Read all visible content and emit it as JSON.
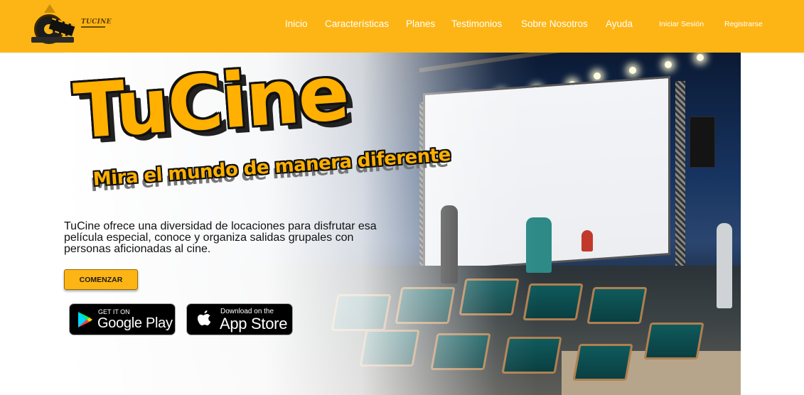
{
  "navbar": {
    "brand": "TUCINE",
    "links": [
      "Inicio",
      "Características",
      "Planes",
      "Testimonios",
      "Sobre Nosotros",
      "Ayuda"
    ],
    "login": "Iniciar Sesión",
    "register": "Registrarse",
    "bg_color": "#fdb515"
  },
  "hero": {
    "title": "TuCine",
    "tagline": "Mira el mundo de manera diferente",
    "description": "TuCine ofrece una diversidad de locaciones para disfrutar esa película especial, conoce y organiza salidas grupales con personas aficionadas al cine.",
    "cta": "COMENZAR",
    "google_play": {
      "small": "GET IT ON",
      "big": "Google Play",
      "icon": "google-play-icon"
    },
    "app_store": {
      "small": "Download on the",
      "big": "App Store",
      "icon": "apple-icon"
    },
    "accent_color": "#ffb000"
  }
}
